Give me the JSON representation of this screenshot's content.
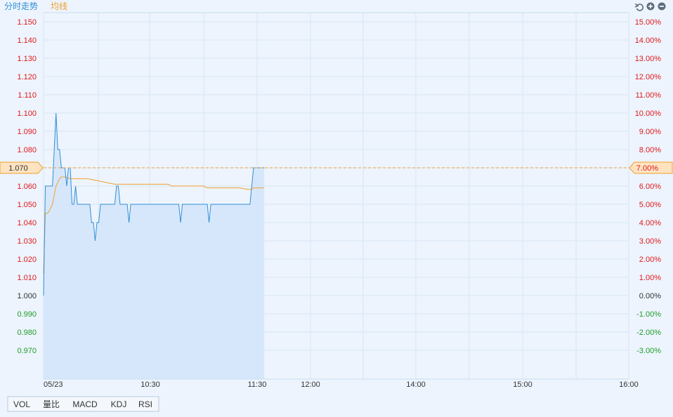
{
  "header": {
    "title": "分时走势",
    "avg_legend": "均线",
    "tools": [
      "undo-icon",
      "zoom-in-icon",
      "zoom-out-icon"
    ]
  },
  "colors": {
    "background": "#edf4fd",
    "grid": "#d6e6f5",
    "price_line": "#2f8fd8",
    "area_fill": "#cfe3fa",
    "avg_line": "#f0a030",
    "up": "#e0191c",
    "down": "#1f9d2b",
    "neutral": "#333333",
    "marker_fill": "#fde3c0",
    "marker_border": "#f0a030",
    "title": "#2f8fd8"
  },
  "chart_data": {
    "type": "line",
    "prev_close": 1.0,
    "ylim": [
      0.96,
      1.16
    ],
    "y_ticks": [
      "1.150",
      "1.140",
      "1.130",
      "1.120",
      "1.110",
      "1.100",
      "1.090",
      "1.080",
      "1.070",
      "1.060",
      "1.050",
      "1.040",
      "1.030",
      "1.020",
      "1.010",
      "1.000",
      "0.990",
      "0.980",
      "0.970"
    ],
    "y_tick_values": [
      1.15,
      1.14,
      1.13,
      1.12,
      1.11,
      1.1,
      1.09,
      1.08,
      1.07,
      1.06,
      1.05,
      1.04,
      1.03,
      1.02,
      1.01,
      1.0,
      0.99,
      0.98,
      0.97
    ],
    "pct_ticks": [
      "15.00%",
      "14.00%",
      "13.00%",
      "12.00%",
      "11.00%",
      "10.00%",
      "9.00%",
      "8.00%",
      "7.00%",
      "6.00%",
      "5.00%",
      "4.00%",
      "3.00%",
      "2.00%",
      "1.00%",
      "0.00%",
      "-1.00%",
      "-2.00%",
      "-3.00%"
    ],
    "x_ticks": [
      {
        "label": "05/23",
        "minute": 0
      },
      {
        "label": "10:30",
        "minute": 60
      },
      {
        "label": "11:30",
        "minute": 120
      },
      {
        "label": "12:00",
        "minute": 150
      },
      {
        "label": "14:00",
        "minute": 180
      },
      {
        "label": "15:00",
        "minute": 240
      },
      {
        "label": "16:00",
        "minute": 330
      }
    ],
    "x_max": 330,
    "current_price": "1.070",
    "current_pct": "7.00%",
    "current_value": 1.07,
    "series": [
      {
        "name": "分时走势",
        "points": [
          [
            0,
            1.0
          ],
          [
            1,
            1.06
          ],
          [
            2,
            1.06
          ],
          [
            3,
            1.06
          ],
          [
            4,
            1.06
          ],
          [
            5,
            1.06
          ],
          [
            6,
            1.08
          ],
          [
            7,
            1.1
          ],
          [
            8,
            1.08
          ],
          [
            9,
            1.08
          ],
          [
            10,
            1.07
          ],
          [
            11,
            1.07
          ],
          [
            12,
            1.07
          ],
          [
            13,
            1.06
          ],
          [
            14,
            1.07
          ],
          [
            15,
            1.07
          ],
          [
            16,
            1.05
          ],
          [
            17,
            1.05
          ],
          [
            18,
            1.06
          ],
          [
            19,
            1.05
          ],
          [
            20,
            1.05
          ],
          [
            21,
            1.05
          ],
          [
            22,
            1.05
          ],
          [
            23,
            1.05
          ],
          [
            24,
            1.05
          ],
          [
            25,
            1.05
          ],
          [
            26,
            1.05
          ],
          [
            27,
            1.04
          ],
          [
            28,
            1.04
          ],
          [
            29,
            1.03
          ],
          [
            30,
            1.04
          ],
          [
            31,
            1.04
          ],
          [
            32,
            1.05
          ],
          [
            33,
            1.05
          ],
          [
            34,
            1.05
          ],
          [
            35,
            1.05
          ],
          [
            36,
            1.05
          ],
          [
            37,
            1.05
          ],
          [
            38,
            1.05
          ],
          [
            39,
            1.05
          ],
          [
            40,
            1.05
          ],
          [
            41,
            1.06
          ],
          [
            42,
            1.06
          ],
          [
            43,
            1.05
          ],
          [
            44,
            1.05
          ],
          [
            45,
            1.05
          ],
          [
            46,
            1.05
          ],
          [
            47,
            1.05
          ],
          [
            48,
            1.04
          ],
          [
            49,
            1.05
          ],
          [
            50,
            1.05
          ],
          [
            60,
            1.05
          ],
          [
            70,
            1.05
          ],
          [
            72,
            1.05
          ],
          [
            76,
            1.05
          ],
          [
            77,
            1.04
          ],
          [
            78,
            1.05
          ],
          [
            80,
            1.05
          ],
          [
            90,
            1.05
          ],
          [
            92,
            1.05
          ],
          [
            93,
            1.04
          ],
          [
            94,
            1.05
          ],
          [
            100,
            1.05
          ],
          [
            110,
            1.05
          ],
          [
            116,
            1.05
          ],
          [
            117,
            1.06
          ],
          [
            118,
            1.07
          ],
          [
            120,
            1.07
          ],
          [
            124,
            1.07
          ]
        ]
      },
      {
        "name": "均线",
        "points": [
          [
            0,
            1.012
          ],
          [
            1,
            1.045
          ],
          [
            2,
            1.045
          ],
          [
            3,
            1.046
          ],
          [
            4,
            1.048
          ],
          [
            5,
            1.05
          ],
          [
            6,
            1.055
          ],
          [
            7,
            1.06
          ],
          [
            8,
            1.062
          ],
          [
            9,
            1.064
          ],
          [
            10,
            1.065
          ],
          [
            12,
            1.065
          ],
          [
            15,
            1.064
          ],
          [
            20,
            1.064
          ],
          [
            25,
            1.064
          ],
          [
            30,
            1.063
          ],
          [
            40,
            1.061
          ],
          [
            60,
            1.061
          ],
          [
            70,
            1.061
          ],
          [
            72,
            1.06
          ],
          [
            90,
            1.06
          ],
          [
            92,
            1.059
          ],
          [
            100,
            1.059
          ],
          [
            110,
            1.059
          ],
          [
            116,
            1.058
          ],
          [
            118,
            1.059
          ],
          [
            124,
            1.059
          ]
        ]
      }
    ]
  },
  "indicator_tabs": [
    "VOL",
    "量比",
    "MACD",
    "KDJ",
    "RSI"
  ]
}
